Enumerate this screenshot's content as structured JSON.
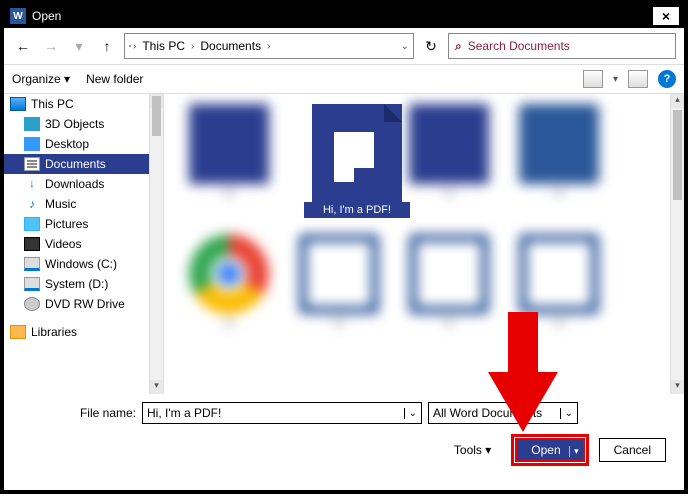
{
  "titlebar": {
    "title": "Open"
  },
  "breadcrumb": {
    "segments": [
      "This PC",
      "Documents"
    ]
  },
  "search": {
    "placeholder": "Search Documents"
  },
  "cmdbar": {
    "organize": "Organize",
    "newfolder": "New folder"
  },
  "tree": {
    "root": "This PC",
    "items": [
      {
        "label": "3D Objects"
      },
      {
        "label": "Desktop"
      },
      {
        "label": "Documents",
        "selected": true
      },
      {
        "label": "Downloads"
      },
      {
        "label": "Music"
      },
      {
        "label": "Pictures"
      },
      {
        "label": "Videos"
      },
      {
        "label": "Windows (C:)"
      },
      {
        "label": "System (D:)"
      },
      {
        "label": "DVD RW Drive"
      }
    ],
    "libraries": "Libraries"
  },
  "selected_file": {
    "name": "Hi, I'm a PDF!"
  },
  "bottom": {
    "filename_label": "File name:",
    "filename_value": "Hi, I'm a PDF!",
    "filter": "All Word Documents",
    "tools": "Tools",
    "open": "Open",
    "cancel": "Cancel"
  }
}
